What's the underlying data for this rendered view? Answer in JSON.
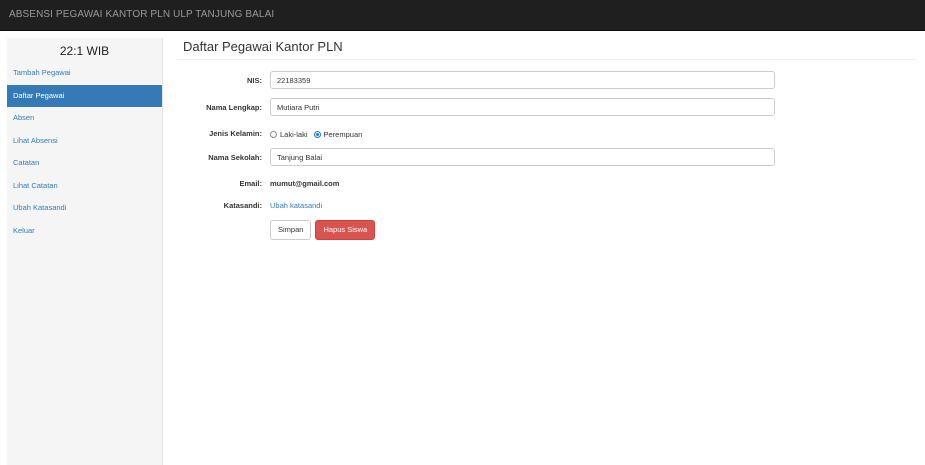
{
  "app": {
    "title": "ABSENSI PEGAWAI KANTOR PLN ULP TANJUNG BALAI"
  },
  "sidebar": {
    "clock": "22:1 WIB",
    "items": [
      {
        "label": "Tambah Pegawai",
        "active": false
      },
      {
        "label": "Daftar Pegawai",
        "active": true
      },
      {
        "label": "Absen",
        "active": false
      },
      {
        "label": "Lihat Absensi",
        "active": false
      },
      {
        "label": "Catatan",
        "active": false
      },
      {
        "label": "Lihat Catatan",
        "active": false
      },
      {
        "label": "Ubah Katasandi",
        "active": false
      },
      {
        "label": "Keluar",
        "active": false
      }
    ]
  },
  "main": {
    "title": "Daftar Pegawai Kantor PLN",
    "form": {
      "nis": {
        "label": "NIS:",
        "value": "22183359"
      },
      "nama": {
        "label": "Nama Lengkap:",
        "value": "Mutiara Putri"
      },
      "jenis_kelamin": {
        "label": "Jenis Kelamin:",
        "options": [
          {
            "label": "Laki-laki",
            "checked": false
          },
          {
            "label": "Perempuan",
            "checked": true
          }
        ]
      },
      "sekolah": {
        "label": "Nama Sekolah:",
        "value": "Tanjung Balai"
      },
      "email": {
        "label": "Email:",
        "value": "mumut@gmail.com"
      },
      "katasandi": {
        "label": "Katasandi:",
        "link": "Ubah katasandi"
      },
      "buttons": {
        "save": "Simpan",
        "delete": "Hapus Siswa"
      }
    }
  },
  "colors": {
    "accent": "#337ab7",
    "danger": "#d9534f",
    "navbar": "#1f1f1f"
  }
}
